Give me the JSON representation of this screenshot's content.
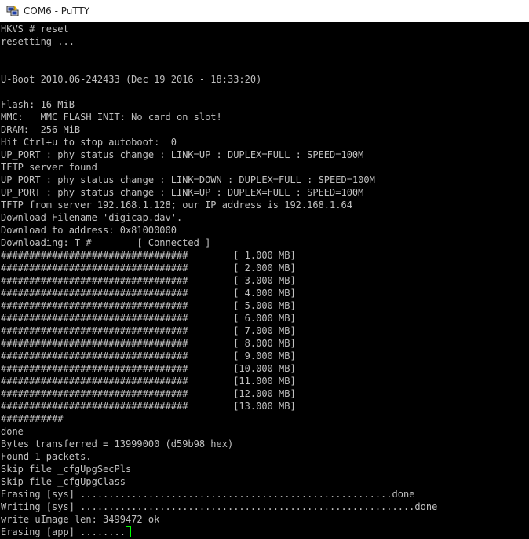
{
  "window": {
    "title": "COM6 - PuTTY",
    "icon": "putty-app-icon"
  },
  "colors": {
    "terminal_bg": "#000000",
    "terminal_fg": "#c0c0c0",
    "cursor": "#00ff00",
    "titlebar_bg": "#ffffff"
  },
  "terminal": {
    "lines": [
      "HKVS # reset",
      "resetting ...",
      "",
      "",
      "U-Boot 2010.06-242433 (Dec 19 2016 - 18:33:20)",
      "",
      "Flash: 16 MiB",
      "MMC:   MMC FLASH INIT: No card on slot!",
      "DRAM:  256 MiB",
      "Hit Ctrl+u to stop autoboot:  0",
      "UP_PORT : phy status change : LINK=UP : DUPLEX=FULL : SPEED=100M",
      "TFTP server found",
      "UP_PORT : phy status change : LINK=DOWN : DUPLEX=FULL : SPEED=100M",
      "UP_PORT : phy status change : LINK=UP : DUPLEX=FULL : SPEED=100M",
      "TFTP from server 192.168.1.128; our IP address is 192.168.1.64",
      "Download Filename 'digicap.dav'.",
      "Download to address: 0x81000000",
      "Downloading: T #        [ Connected ]",
      "#################################        [ 1.000 MB]",
      "#################################        [ 2.000 MB]",
      "#################################        [ 3.000 MB]",
      "#################################        [ 4.000 MB]",
      "#################################        [ 5.000 MB]",
      "#################################        [ 6.000 MB]",
      "#################################        [ 7.000 MB]",
      "#################################        [ 8.000 MB]",
      "#################################        [ 9.000 MB]",
      "#################################        [10.000 MB]",
      "#################################        [11.000 MB]",
      "#################################        [12.000 MB]",
      "#################################        [13.000 MB]",
      "###########",
      "done",
      "Bytes transferred = 13999000 (d59b98 hex)",
      "Found 1 packets.",
      "Skip file _cfgUpgSecPls",
      "Skip file _cfgUpgClass",
      "Erasing [sys] .......................................................done",
      "Writing [sys] ...........................................................done",
      "write uImage len: 3499472 ok",
      "Erasing [app] ........"
    ]
  }
}
